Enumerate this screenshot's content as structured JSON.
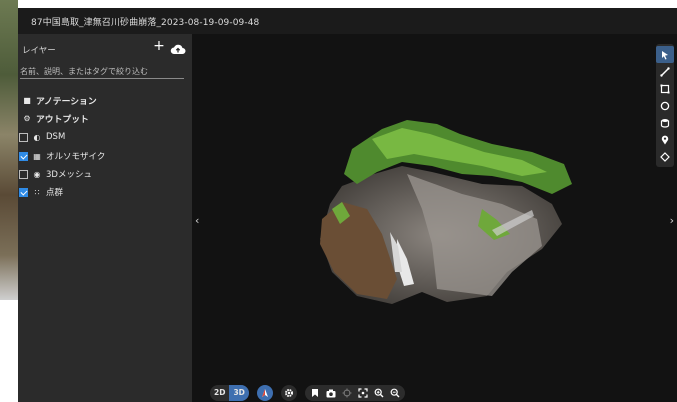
{
  "window": {
    "title": "87中国島取_津無召川砂曲崩落_2023-08-19-09-09-48"
  },
  "sidebar": {
    "layers_label": "レイヤー",
    "add_icon": "plus-icon",
    "upload_icon": "cloud-upload-icon",
    "search_placeholder": "名前、説明、またはタグで絞り込む",
    "sections": [
      {
        "label": "アノテーション",
        "icon": "annotation-icon"
      },
      {
        "label": "アウトプット",
        "icon": "gear-icon"
      }
    ],
    "layers": [
      {
        "label": "DSM",
        "checked": false,
        "icon": "dsm-icon"
      },
      {
        "label": "オルソモザイク",
        "checked": true,
        "icon": "ortho-icon"
      },
      {
        "label": "3Dメッシュ",
        "checked": false,
        "icon": "mesh-icon"
      },
      {
        "label": "点群",
        "checked": true,
        "icon": "pointcloud-icon"
      }
    ]
  },
  "viewport": {
    "left_arrow": "‹",
    "right_arrow": "›",
    "tools": [
      "select-cursor-icon",
      "measure-line-icon",
      "area-icon",
      "circle-icon",
      "volume-icon",
      "pin-icon",
      "height-icon"
    ],
    "active_tool": "select-cursor-icon"
  },
  "bottombar": {
    "mode_2d": "2D",
    "mode_3d": "3D",
    "active_mode": "3D",
    "buttons": [
      "compass-icon",
      "settings-icon",
      "bookmark-icon",
      "camera-icon",
      "target-icon",
      "fit-view-icon",
      "zoom-in-icon",
      "zoom-out-icon"
    ]
  },
  "colors": {
    "accent": "#3e6fb0",
    "checkbox": "#2f8be6",
    "sidebar_bg": "#2b2b2b",
    "viewport_bg": "#121212"
  }
}
